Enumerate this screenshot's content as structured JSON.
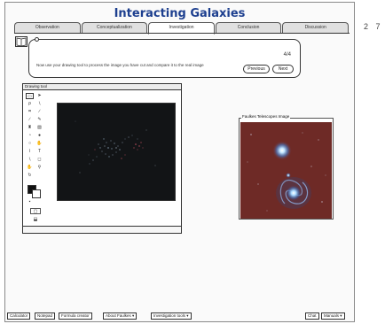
{
  "app": {
    "title": "Interacting Galaxies"
  },
  "tabs": [
    {
      "label": "Observation",
      "active": false
    },
    {
      "label": "Conceptualization",
      "active": false
    },
    {
      "label": "Investigation",
      "active": true
    },
    {
      "label": "Conclusion",
      "active": false
    },
    {
      "label": "Discussion",
      "active": false
    }
  ],
  "instructions": {
    "page_count": "4/4",
    "text": "Now use your drawing tool to process the image you have cut and compare it to the real image",
    "prev_label": "Previous",
    "next_label": "Next"
  },
  "margin_note": "2 7",
  "drawing_tool": {
    "title": "Drawing tool",
    "tools": [
      "marquee-tool-icon",
      "arrow-tool-icon",
      "lasso-tool-icon",
      "magic-wand-icon",
      "crop-tool-icon",
      "eyedropper-icon",
      "brush-tool-icon",
      "pencil-tool-icon",
      "stamp-tool-icon",
      "eraser-tool-icon",
      "fill-tool-icon",
      "blur-tool-icon",
      "dodge-tool-icon",
      "burn-tool-icon",
      "pen-tool-icon",
      "text-tool-icon",
      "line-tool-icon",
      "shape-tool-icon",
      "hand-tool-icon",
      "zoom-tool-icon"
    ],
    "colors": {
      "foreground": "#111111",
      "background": "#ffffff"
    }
  },
  "faulkes": {
    "title": "Faulkes Telescopes Image"
  },
  "bottom_bar": {
    "calculator": "Calculator",
    "notepad": "Notepad",
    "formula_creator": "Formula creator",
    "about_faulkes": "About Faulkes ▾",
    "investigation_tools": "Investigation tools ▾",
    "chat": "Chat",
    "manuals": "Manuals ▾"
  },
  "colors": {
    "title": "#1d3f8f",
    "galaxy_bg": "#6e2a26",
    "galaxy_core": "#9fd4ff"
  }
}
